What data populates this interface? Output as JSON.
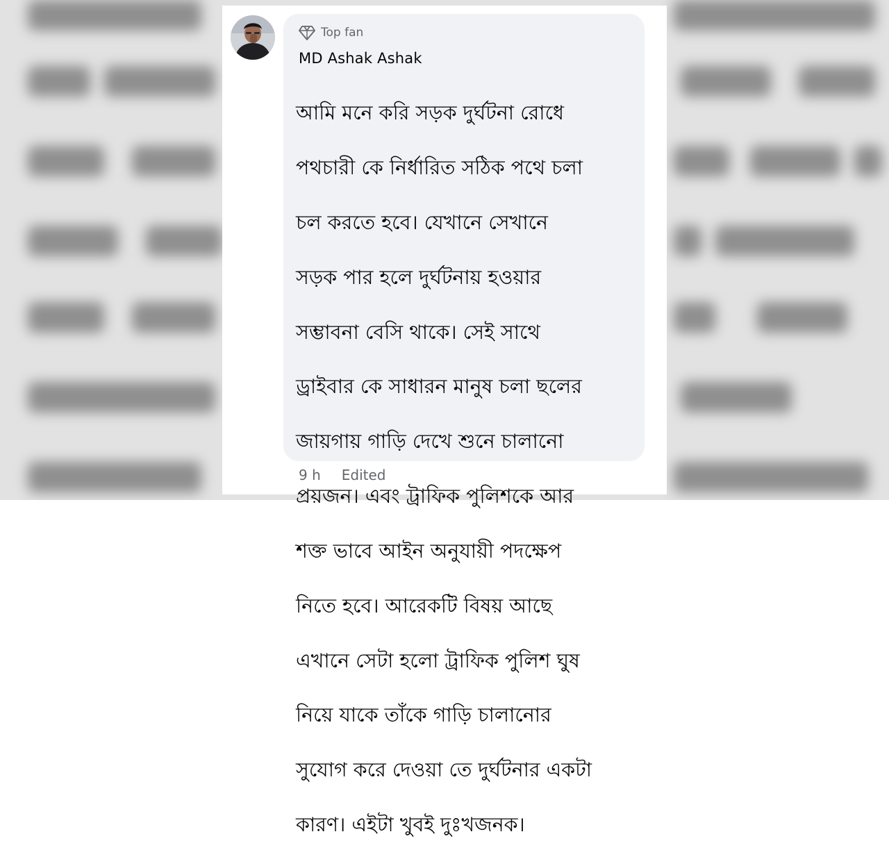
{
  "comment": {
    "badge_label": "Top fan",
    "badge_icon": "diamond-icon",
    "author": "MD Ashak Ashak",
    "lines": [
      "আমি মনে করি সড়ক দুর্ঘটনা রোধে",
      "পথচারী কে নির্ধারিত সঠিক পথে চলা",
      "চল করতে হবে। যেখানে সেখানে",
      "সড়ক পার হলে দুর্ঘটনায় হওয়ার",
      "সম্ভাবনা বেসি থাকে। সেই সাথে",
      "ড্রাইবার কে সাধারন মানুষ চলা ছলের",
      "জায়গায় গাড়ি দেখে শুনে চালানো",
      "প্রয়জন। এবং ট্রাফিক পুলিশকে আর",
      "শক্ত ভাবে আইন অনুযায়ী পদক্ষেপ",
      "নিতে হবে। আরেকটি বিষয় আছে",
      "এখানে সেটা হলো ট্রাফিক পুলিশ ঘুষ",
      "নিয়ে যাকে তাঁকে গাড়ি চালানোর",
      "সুযোগ করে দেওয়া তে দুর্ঘটনার একটা",
      "কারণ। এইটা খুবই দুঃখজনক।"
    ],
    "time": "9 h",
    "edited_label": "Edited"
  },
  "colors": {
    "bubble_bg": "#f0f2f5",
    "meta_text": "#65676b",
    "body_text": "#050505"
  }
}
